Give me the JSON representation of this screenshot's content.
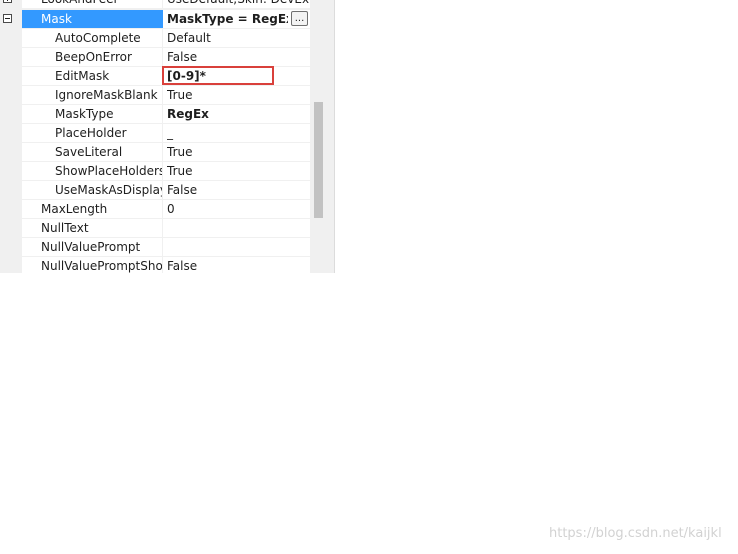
{
  "grid": {
    "rows": [
      {
        "name": "LookAndFeel",
        "value": "UseDefault;Skin: DevExpr"
      },
      {
        "name": "Mask",
        "value": "MaskType = RegEx, E"
      },
      {
        "name": "AutoComplete",
        "value": "Default"
      },
      {
        "name": "BeepOnError",
        "value": "False"
      },
      {
        "name": "EditMask",
        "value": "[0-9]*"
      },
      {
        "name": "IgnoreMaskBlank",
        "value": "True"
      },
      {
        "name": "MaskType",
        "value": "RegEx"
      },
      {
        "name": "PlaceHolder",
        "value": "_"
      },
      {
        "name": "SaveLiteral",
        "value": "True"
      },
      {
        "name": "ShowPlaceHolders",
        "value": "True"
      },
      {
        "name": "UseMaskAsDisplayFormat",
        "value": "False"
      },
      {
        "name": "MaxLength",
        "value": "0"
      },
      {
        "name": "NullText",
        "value": ""
      },
      {
        "name": "NullValuePrompt",
        "value": ""
      },
      {
        "name": "NullValuePromptShowForEmptyValue",
        "value": "False"
      }
    ],
    "ellipsis_label": "..."
  },
  "watermark": "https://blog.csdn.net/kaijkl"
}
